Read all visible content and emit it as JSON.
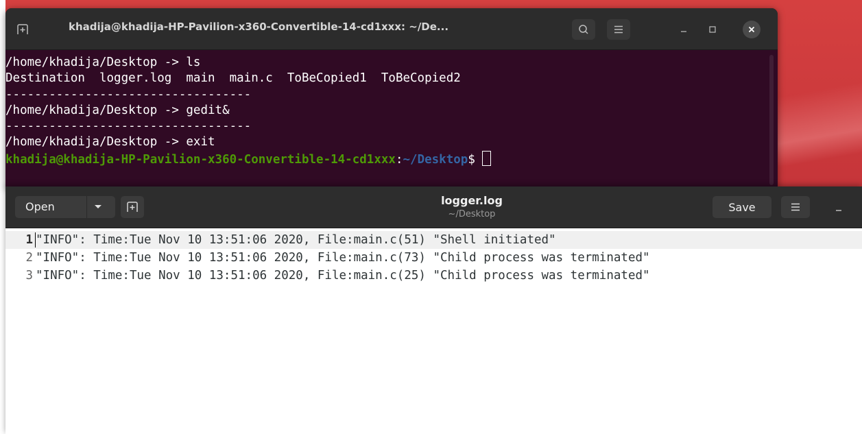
{
  "terminal": {
    "title": "khadija@khadija-HP-Pavilion-x360-Convertible-14-cd1xxx: ~/De...",
    "icons": {
      "new_tab": "new-tab-icon",
      "search": "search-icon",
      "menu": "hamburger-menu-icon",
      "minimize": "minimize-icon",
      "maximize": "maximize-icon",
      "close": "close-icon"
    },
    "lines": [
      "/home/khadija/Desktop -> ls",
      "Destination  logger.log  main  main.c  ToBeCopied1  ToBeCopied2",
      "----------------------------------",
      "/home/khadija/Desktop -> gedit&",
      "----------------------------------",
      "/home/khadija/Desktop -> exit"
    ],
    "prompt": {
      "user_host": "khadija@khadija-HP-Pavilion-x360-Convertible-14-cd1xxx",
      "separator": ":",
      "path": "~/Desktop",
      "symbol": "$ "
    }
  },
  "gedit": {
    "open_label": "Open",
    "title": "logger.log",
    "subtitle": "~/Desktop",
    "save_label": "Save",
    "icons": {
      "open_dropdown": "chevron-down-icon",
      "new_document": "new-document-icon",
      "menu": "hamburger-menu-icon",
      "minimize": "minimize-icon"
    },
    "line_numbers": [
      "1",
      "2",
      "3"
    ],
    "lines": [
      "\"INFO\": Time:Tue Nov 10 13:51:06 2020, File:main.c(51) \"Shell initiated\"",
      "\"INFO\": Time:Tue Nov 10 13:51:06 2020, File:main.c(73) \"Child process was terminated\"",
      "\"INFO\": Time:Tue Nov 10 13:51:06 2020, File:main.c(25) \"Child process was terminated\""
    ]
  },
  "colors": {
    "terminal_bg": "#300a24",
    "prompt_user": "#4e9a06",
    "prompt_path": "#3465a4",
    "header_bg": "#2d2d2d"
  }
}
